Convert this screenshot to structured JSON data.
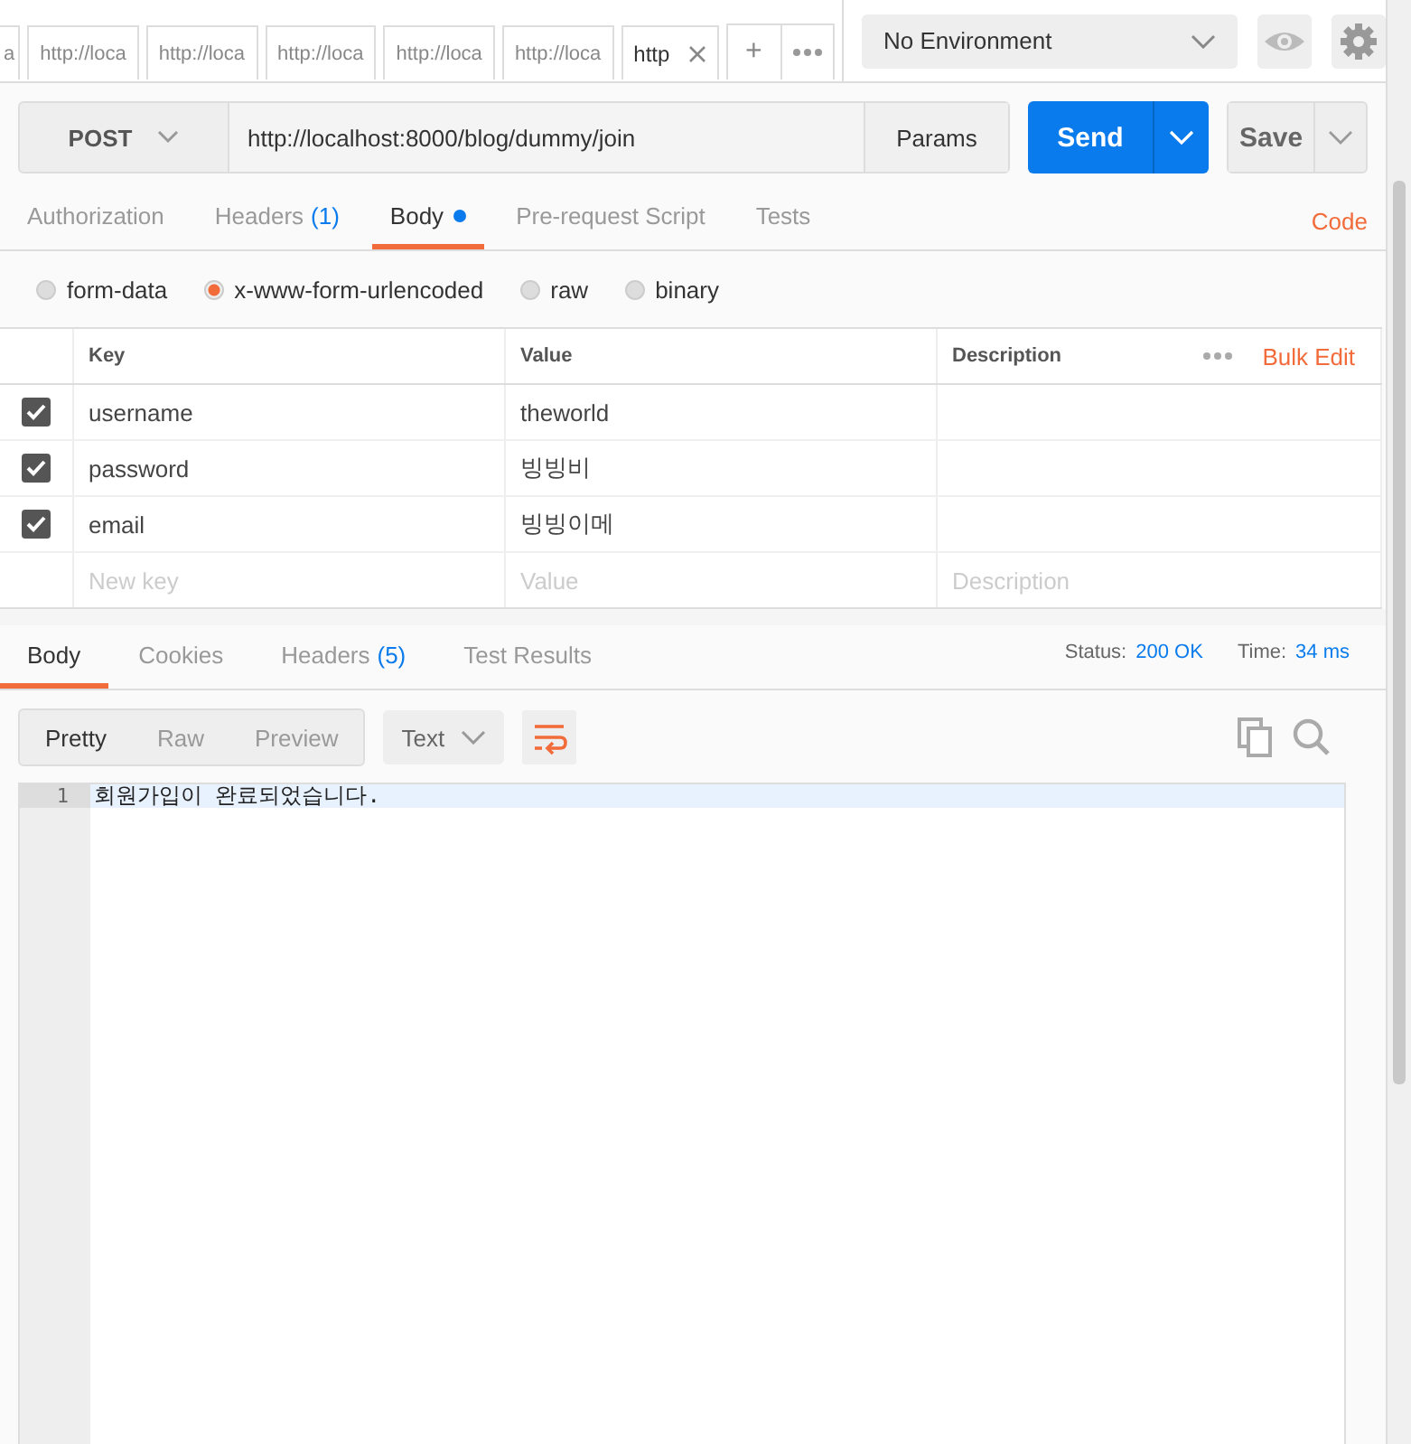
{
  "tabs": [
    {
      "label": "a",
      "selected": false,
      "closable": false
    },
    {
      "label": "http://loca",
      "selected": false,
      "closable": false
    },
    {
      "label": "http://loca",
      "selected": false,
      "closable": false
    },
    {
      "label": "http://loca",
      "selected": false,
      "closable": false
    },
    {
      "label": "http://loca",
      "selected": false,
      "closable": false
    },
    {
      "label": "http://loca",
      "selected": false,
      "closable": false
    },
    {
      "label": "http",
      "selected": true,
      "closable": true
    }
  ],
  "add_tab": "+",
  "environment": "No Environment",
  "request": {
    "method": "POST",
    "url": "http://localhost:8000/blog/dummy/join",
    "params": "Params",
    "send": "Send",
    "save": "Save"
  },
  "request_tabs": [
    {
      "label": "Authorization",
      "selected": false,
      "dot": false
    },
    {
      "label": "Headers",
      "count": "(1)",
      "selected": false,
      "dot": false
    },
    {
      "label": "Body",
      "selected": true,
      "dot": true
    },
    {
      "label": "Pre-request Script",
      "selected": false,
      "dot": false
    },
    {
      "label": "Tests",
      "selected": false,
      "dot": false
    }
  ],
  "code_link": "Code",
  "body_types": [
    {
      "label": "form-data",
      "selected": false
    },
    {
      "label": "x-www-form-urlencoded",
      "selected": true
    },
    {
      "label": "raw",
      "selected": false
    },
    {
      "label": "binary",
      "selected": false
    }
  ],
  "table": {
    "columns": [
      "Key",
      "Value",
      "Description"
    ],
    "bulk_edit": "Bulk Edit",
    "rows": [
      {
        "checked": true,
        "key": "username",
        "value": "theworld"
      },
      {
        "checked": true,
        "key": "password",
        "value": "빙빙비"
      },
      {
        "checked": true,
        "key": "email",
        "value": "빙빙이메"
      }
    ],
    "new_row": {
      "key_placeholder": "New key",
      "value_placeholder": "Value",
      "description_placeholder": "Description"
    }
  },
  "response_tabs": [
    {
      "label": "Body",
      "selected": true
    },
    {
      "label": "Cookies",
      "selected": false
    },
    {
      "label": "Headers",
      "count": "(5)",
      "selected": false
    },
    {
      "label": "Test Results",
      "selected": false
    }
  ],
  "status": {
    "label": "Status:",
    "value": "200 OK"
  },
  "time": {
    "label": "Time:",
    "value": "34 ms"
  },
  "view_modes": [
    {
      "label": "Pretty",
      "selected": true
    },
    {
      "label": "Raw",
      "selected": false
    },
    {
      "label": "Preview",
      "selected": false
    }
  ],
  "format": "Text",
  "lines": [
    {
      "number": "1",
      "text": "회원가입이 완료되었습니다."
    }
  ]
}
